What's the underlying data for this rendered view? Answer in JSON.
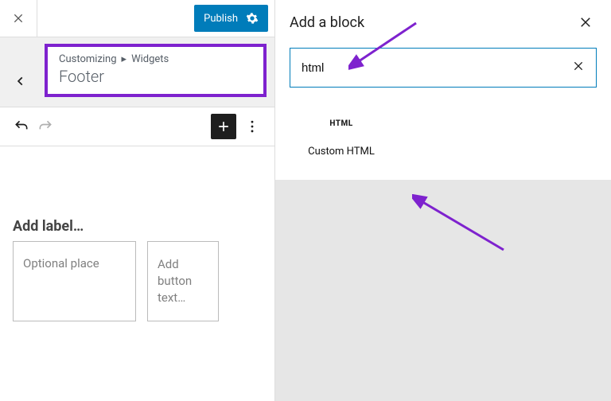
{
  "topbar": {
    "publish_label": "Publish"
  },
  "breadcrumb": {
    "level1": "Customizing",
    "level2": "Widgets",
    "section": "Footer"
  },
  "editor": {
    "add_label": "Add label…",
    "search_placeholder": "Optional place",
    "button_placeholder": "Add button text…"
  },
  "block_panel": {
    "title": "Add a block",
    "search_value": "html",
    "result_badge": "HTML",
    "result_label": "Custom HTML"
  }
}
